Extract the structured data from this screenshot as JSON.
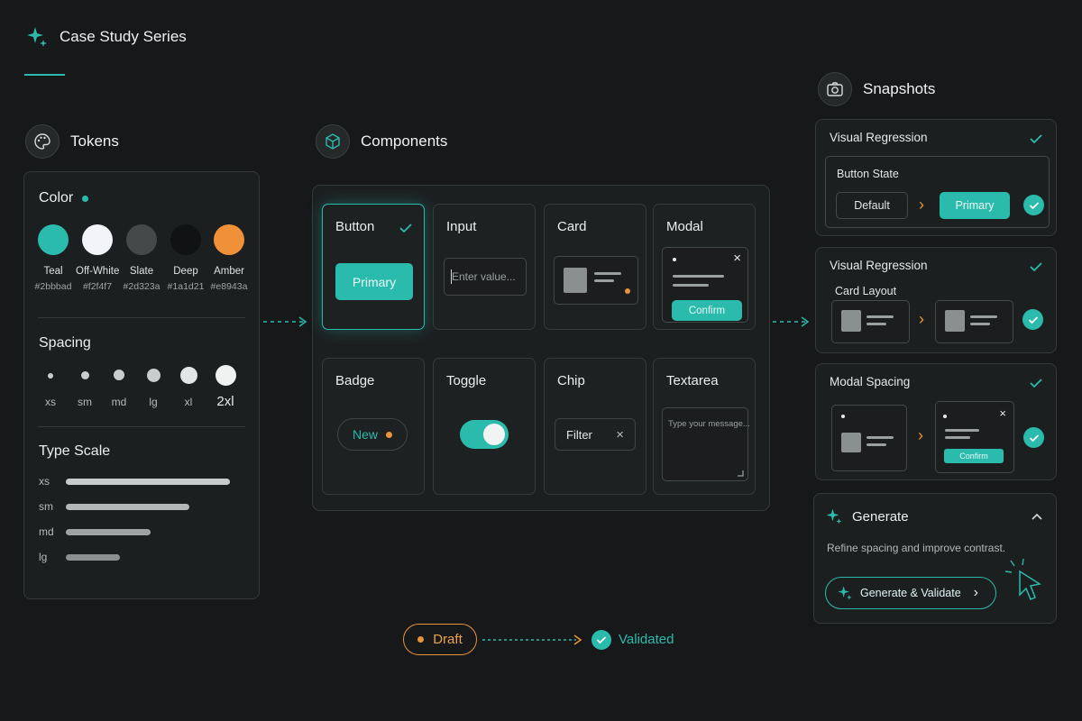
{
  "header": {
    "title": "Case Study Series"
  },
  "tokens": {
    "title": "Tokens",
    "color": {
      "label": "Color",
      "swatches": [
        {
          "name": "Teal",
          "hex": "#2bbbad"
        },
        {
          "name": "Off-White",
          "hex": "#f2f4f7"
        },
        {
          "name": "Slate",
          "hex": "#2d323a"
        },
        {
          "name": "Deep",
          "hex": "#1a1d21"
        },
        {
          "name": "Amber",
          "hex": "#e8943a"
        }
      ]
    },
    "spacing": {
      "label": "Spacing",
      "steps": [
        "xs",
        "sm",
        "md",
        "lg",
        "xl",
        "2xl"
      ]
    },
    "type_scale": {
      "label": "Type Scale",
      "steps": [
        "xs",
        "sm",
        "md",
        "lg"
      ]
    }
  },
  "components": {
    "title": "Components",
    "button": {
      "name": "Button",
      "label": "Primary"
    },
    "input": {
      "name": "Input",
      "placeholder": "Enter value..."
    },
    "card": {
      "name": "Card"
    },
    "modal": {
      "name": "Modal",
      "confirm": "Confirm"
    },
    "badge": {
      "name": "Badge",
      "label": "New"
    },
    "toggle": {
      "name": "Toggle"
    },
    "chip": {
      "name": "Chip",
      "label": "Filter"
    },
    "textarea": {
      "name": "Textarea",
      "placeholder": "Type your message..."
    }
  },
  "snapshots": {
    "title": "Snapshots",
    "items": [
      {
        "title": "Visual Regression",
        "subtitle": "Button State",
        "before": "Default",
        "after": "Primary"
      },
      {
        "title": "Visual Regression",
        "subtitle": "Card Layout"
      },
      {
        "title": "Modal Spacing",
        "confirm": "Confirm"
      }
    ]
  },
  "generate": {
    "title": "Generate",
    "description": "Refine spacing and improve contrast.",
    "button_label": "Generate & Validate"
  },
  "status_flow": {
    "from": "Draft",
    "to": "Validated"
  },
  "colors": {
    "accent": "#2bbbad",
    "amber": "#e8943a",
    "background": "#161819"
  }
}
